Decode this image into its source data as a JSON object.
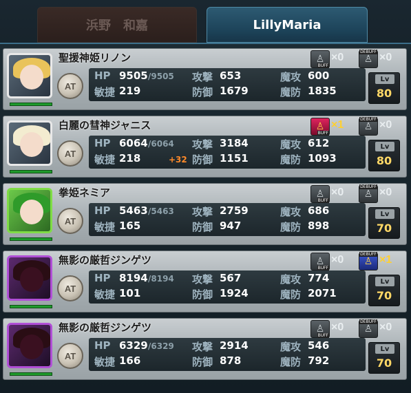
{
  "tabs": [
    {
      "label": "浜野　和嘉",
      "active": false
    },
    {
      "label": "LillyMaria",
      "active": true
    }
  ],
  "labels": {
    "hp": "HP",
    "agi": "敏捷",
    "atk": "攻撃",
    "def": "防御",
    "matk": "魔攻",
    "mdef": "魔防",
    "at": "AT",
    "lv": "Lv",
    "buff": "BUFF",
    "debuff": "DEBUFF"
  },
  "units": [
    {
      "name": "聖援神姫リノン",
      "hp": "9505",
      "hp_max": "/9505",
      "agi": "219",
      "agi_bonus": "",
      "atk": "653",
      "def": "1679",
      "matk": "600",
      "mdef": "1835",
      "buff_count": "×0",
      "debuff_count": "×0",
      "level": "80"
    },
    {
      "name": "白麗の彗神ジャニス",
      "hp": "6064",
      "hp_max": "/6064",
      "agi": "218",
      "agi_bonus": "+32",
      "atk": "3184",
      "def": "1151",
      "matk": "612",
      "mdef": "1093",
      "buff_count": "×1",
      "debuff_count": "×0",
      "level": "80"
    },
    {
      "name": "拳姫ネミア",
      "hp": "5463",
      "hp_max": "/5463",
      "agi": "165",
      "agi_bonus": "",
      "atk": "2759",
      "def": "947",
      "matk": "686",
      "mdef": "898",
      "buff_count": "×0",
      "debuff_count": "×0",
      "level": "70"
    },
    {
      "name": "無影の厳哲ジンゲツ",
      "hp": "8194",
      "hp_max": "/8194",
      "agi": "101",
      "agi_bonus": "",
      "atk": "567",
      "def": "1924",
      "matk": "774",
      "mdef": "2071",
      "buff_count": "×0",
      "debuff_count": "×1",
      "level": "70"
    },
    {
      "name": "無影の厳哲ジンゲツ",
      "hp": "6329",
      "hp_max": "/6329",
      "agi": "166",
      "agi_bonus": "",
      "atk": "2914",
      "def": "878",
      "matk": "546",
      "mdef": "792",
      "buff_count": "×0",
      "debuff_count": "×0",
      "level": "70"
    }
  ],
  "colors": {
    "active_tab": "#1c4258",
    "hp_bar": "#1f9a2c",
    "level_text": "#ffd866",
    "bonus_text": "#ff8a2a"
  }
}
